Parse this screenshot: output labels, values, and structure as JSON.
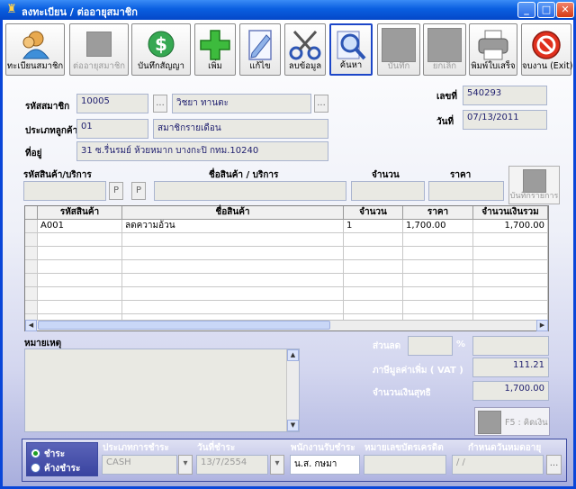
{
  "window": {
    "title": "ลงทะเบียน / ต่ออายุสมาชิก",
    "minimize": "_",
    "maximize": "□",
    "close": "✕"
  },
  "toolbar": [
    {
      "label": "ทะเบียนสมาชิก",
      "icon": "member-icon",
      "enabled": true
    },
    {
      "label": "ต่ออายุสมาชิก",
      "icon": "blank-icon",
      "enabled": false
    },
    {
      "label": "บันทึกสัญญา",
      "icon": "dollar-icon",
      "enabled": true
    },
    {
      "label": "เพิ่ม",
      "icon": "plus-icon",
      "enabled": true
    },
    {
      "label": "แก้ไข",
      "icon": "edit-icon",
      "enabled": true
    },
    {
      "label": "ลบข้อมูล",
      "icon": "scissors-icon",
      "enabled": true
    },
    {
      "label": "ค้นหา",
      "icon": "search-icon",
      "enabled": true,
      "active": true
    },
    {
      "label": "บันทึก",
      "icon": "blank-icon",
      "enabled": false
    },
    {
      "label": "ยกเลิก",
      "icon": "blank-icon",
      "enabled": false
    },
    {
      "label": "พิมพ์ใบเสร็จ",
      "icon": "printer-icon",
      "enabled": true
    },
    {
      "label": "จบงาน (Exit)",
      "icon": "exit-icon",
      "enabled": true
    }
  ],
  "header": {
    "member_code_label": "รหัสสมาชิก",
    "member_code": "10005",
    "member_name": "วิชยา ทานตะ",
    "customer_type_label": "ประเภทลูกค้า",
    "customer_type_code": "01",
    "customer_type_name": "สมาชิกรายเดือน",
    "address_label": "ที่อยู่",
    "address": "31 ซ.รื่นรมย์ ห้วยหมาก บางกะปิ กทม.10240",
    "doc_no_label": "เลขที่",
    "doc_no": "540293",
    "date_label": "วันที่",
    "date": "07/13/2011",
    "ellipsis": "..."
  },
  "entry": {
    "product_code_label": "รหัสสินค้า/บริการ",
    "product_name_label": "ชื่อสินค้า / บริการ",
    "qty_label": "จำนวน",
    "price_label": "ราคา",
    "p_button": "P",
    "save_line_label": "บันทึกรายการ"
  },
  "grid": {
    "columns": [
      "รหัสสินค้า",
      "ชื่อสินค้า",
      "จำนวน",
      "ราคา",
      "จำนวนเงินรวม"
    ],
    "rows": [
      [
        "A001",
        "ลดความอ้วน",
        "1",
        "1,700.00",
        "1,700.00"
      ]
    ]
  },
  "notes": {
    "label": "หมายเหตุ"
  },
  "totals": {
    "discount_label": "ส่วนลด",
    "percent": "%",
    "vat_label": "ภาษีมูลค่าเพิ่ม ( VAT )",
    "vat": "111.21",
    "net_label": "จำนวนเงินสุทธิ",
    "net": "1,700.00",
    "calc_label": "F5 : คิดเงิน"
  },
  "payment": {
    "paid_label": "ชำระ",
    "unpaid_label": "ค้างชำระ",
    "type_label": "ประเภทการชำระ",
    "type": "CASH",
    "pay_date_label": "วันที่ชำระ",
    "pay_date": "13/7/2554",
    "staff_label": "พนักงานรับชำระ",
    "staff": "น.ส. กษมา",
    "card_label": "หมายเลขบัตรเครดิต",
    "expiry_label": "กำหนดวันหมดอายุ",
    "expiry": " /  /",
    "dropdown_arrow": "▾"
  },
  "colors": {
    "titlebar": "#0a5fe0",
    "field_bg": "#e9e9e3",
    "field_text": "#1e1e6e",
    "panel_border": "#3c4aa0"
  }
}
